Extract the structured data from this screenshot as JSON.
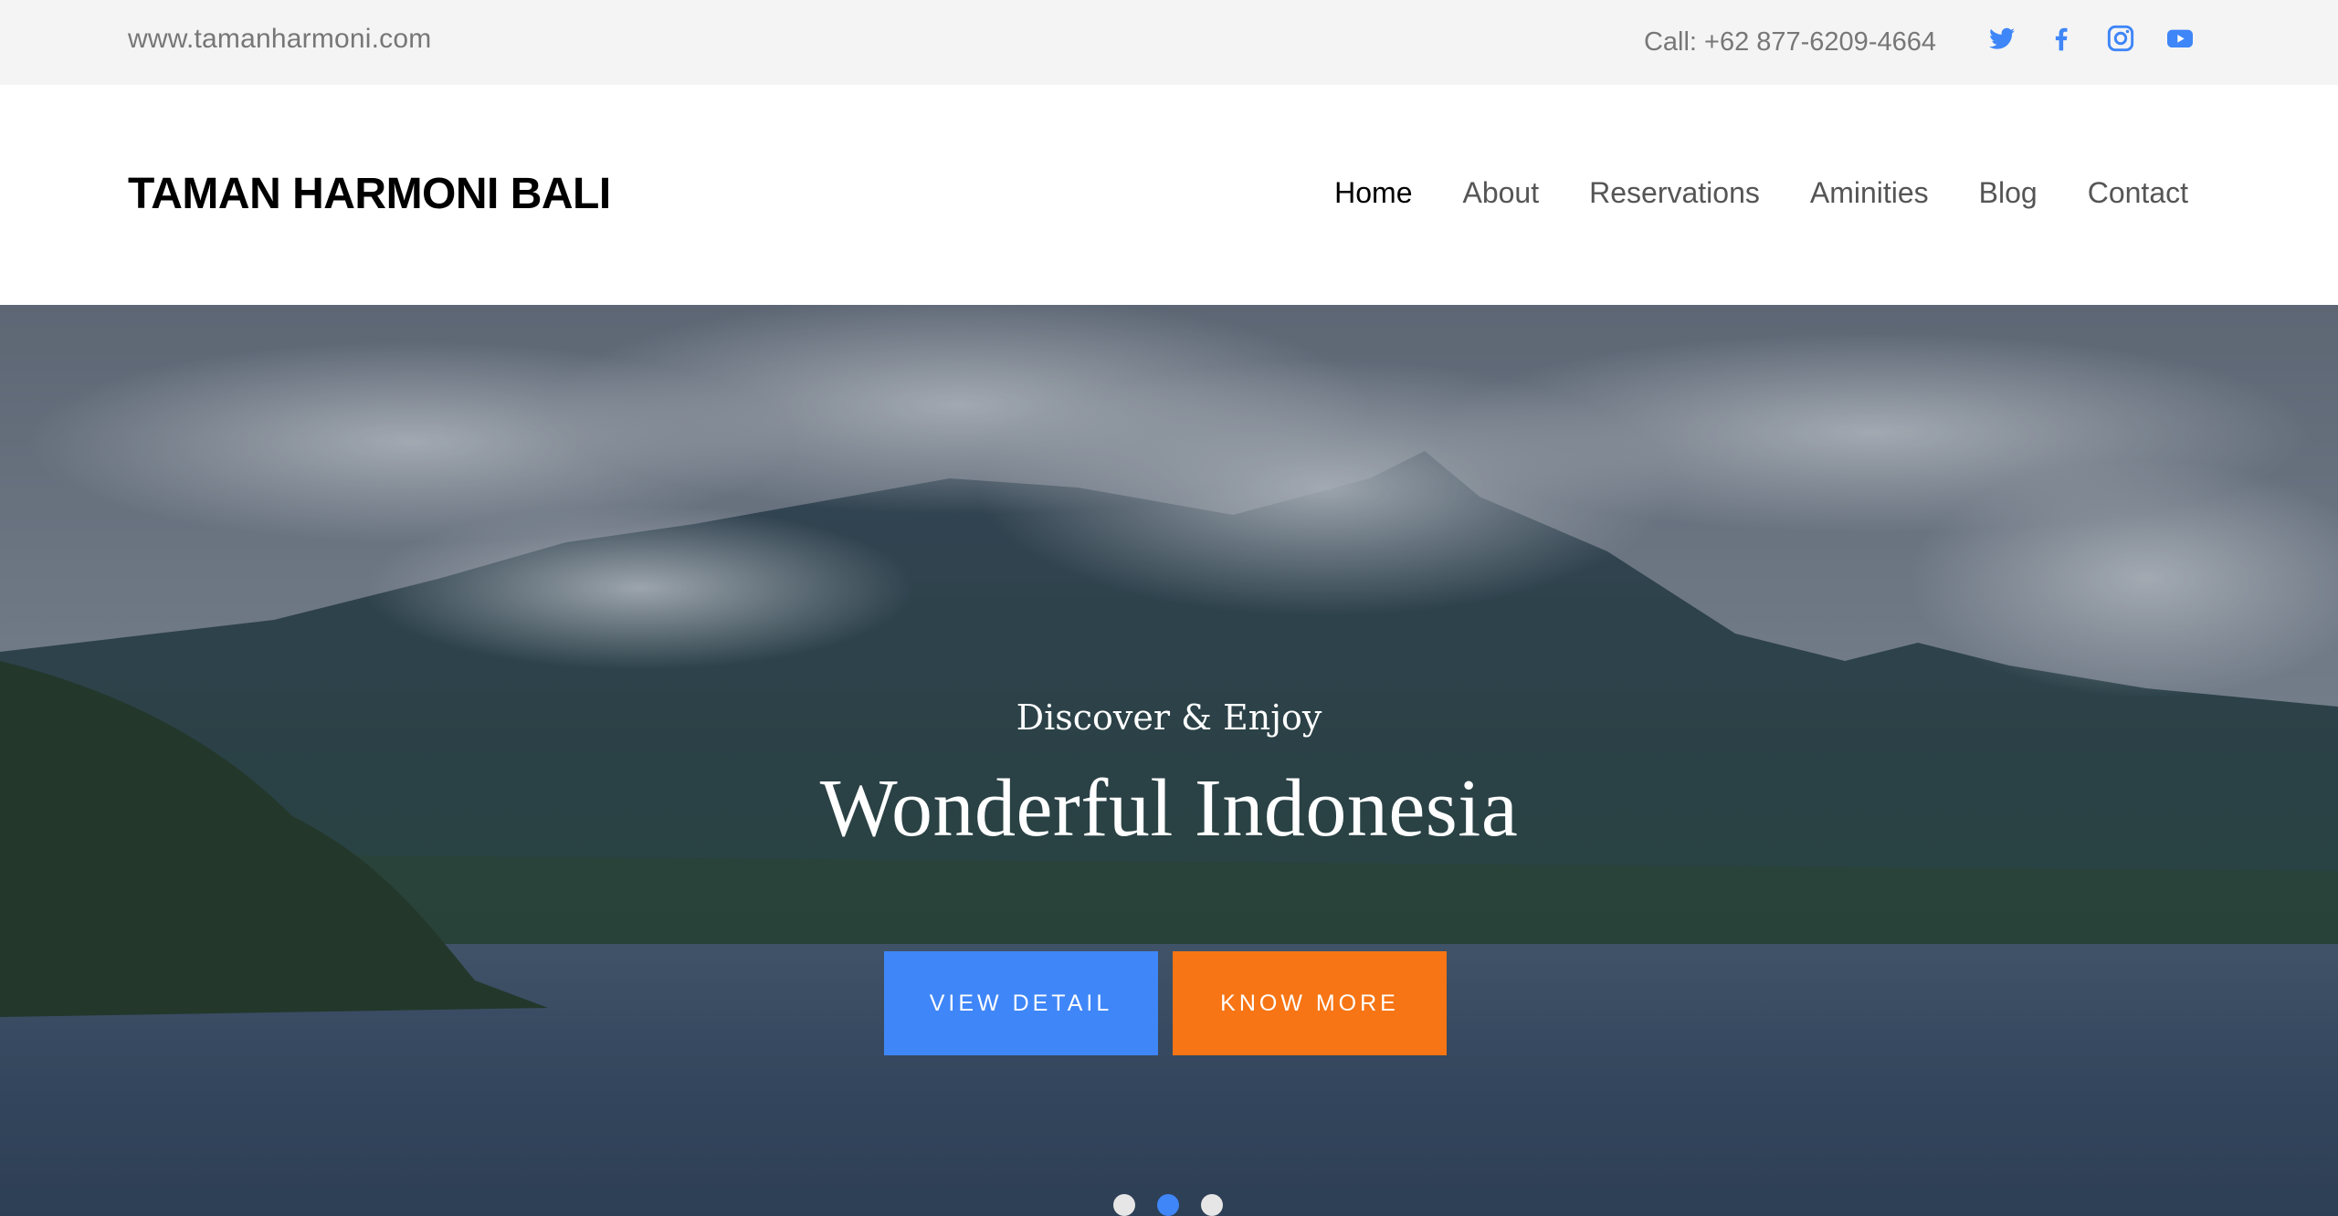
{
  "topbar": {
    "site_url": "www.tamanharmoni.com",
    "phone": "Call: +62 877-6209-4664",
    "social_icons": [
      "twitter-icon",
      "facebook-icon",
      "instagram-icon",
      "youtube-icon"
    ],
    "icon_color": "#3f86f8"
  },
  "header": {
    "brand": "TAMAN HARMONI BALI",
    "nav": [
      {
        "label": "Home",
        "active": true
      },
      {
        "label": "About",
        "active": false
      },
      {
        "label": "Reservations",
        "active": false
      },
      {
        "label": "Aminities",
        "active": false
      },
      {
        "label": "Blog",
        "active": false
      },
      {
        "label": "Contact",
        "active": false
      }
    ]
  },
  "hero": {
    "subtitle": "Discover & Enjoy",
    "title": "Wonderful Indonesia",
    "primary_button": "VIEW DETAIL",
    "secondary_button": "KNOW MORE",
    "primary_color": "#3f86f8",
    "secondary_color": "#f77514",
    "slider": {
      "total": 3,
      "active_index": 1
    }
  }
}
